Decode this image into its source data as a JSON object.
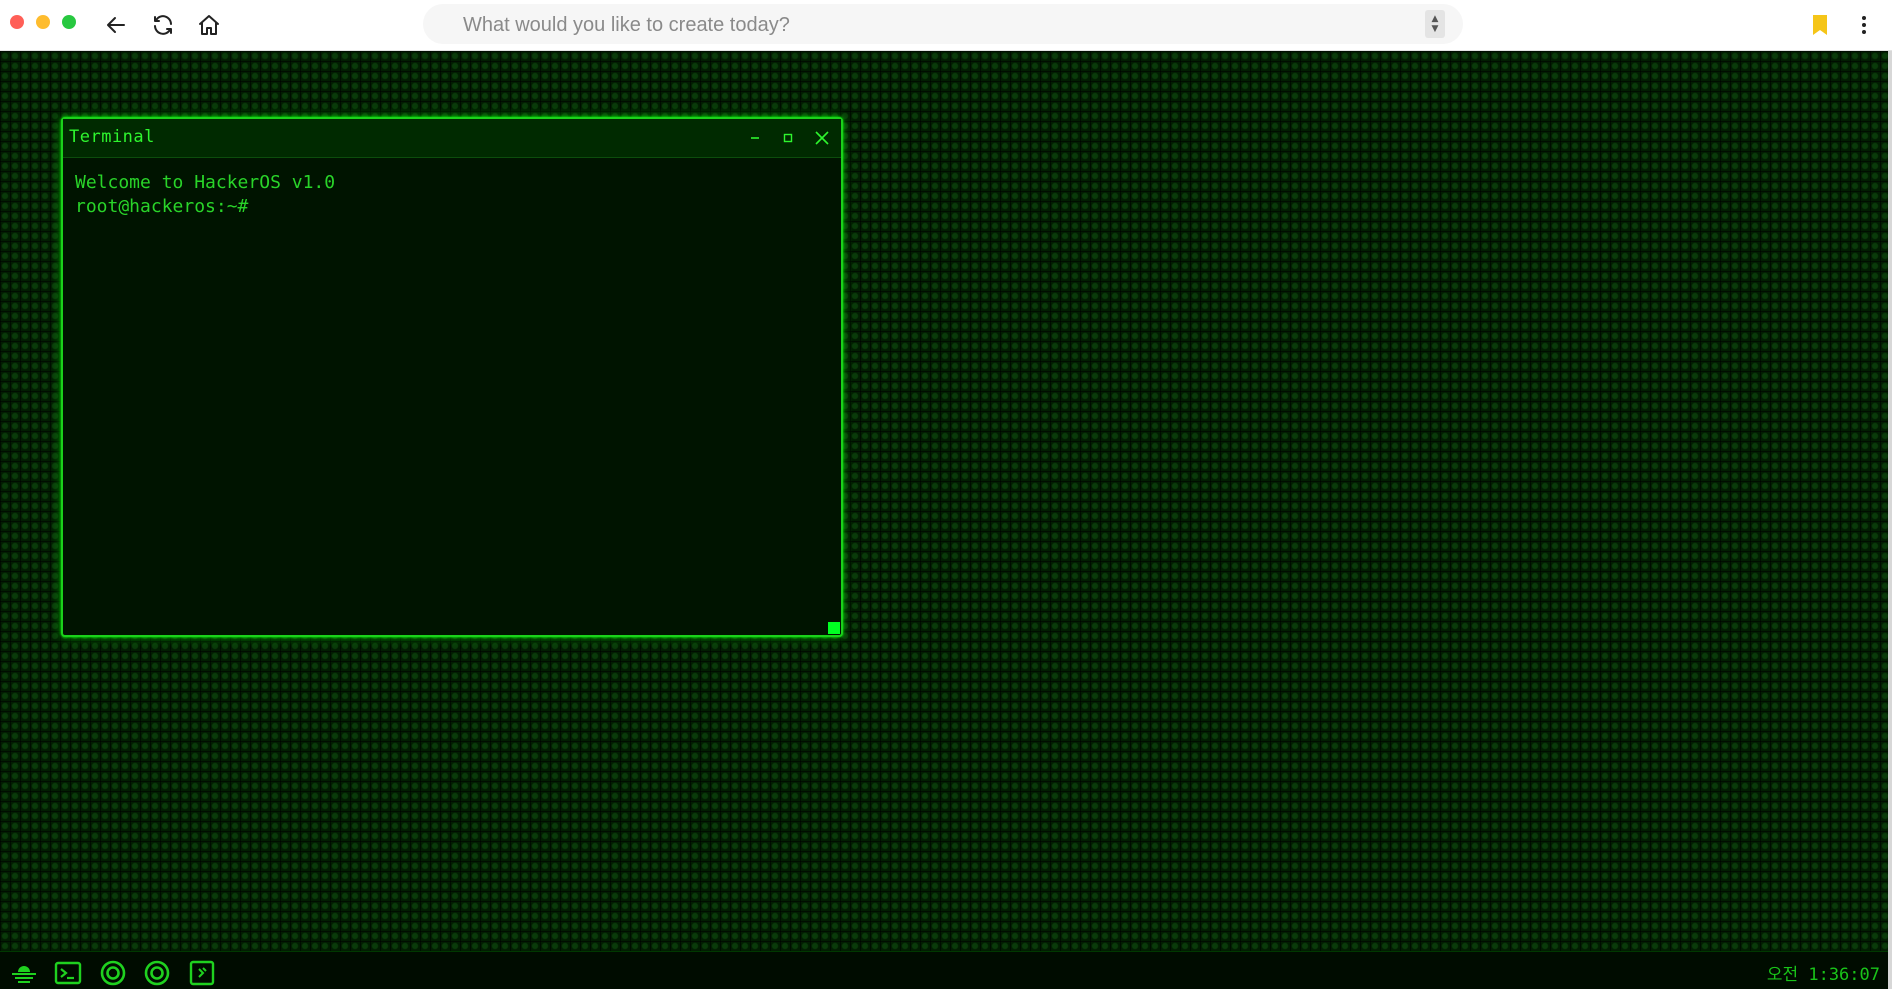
{
  "browser": {
    "url_placeholder": "What would you like to create today?",
    "icons": {
      "back": "arrow-left-icon",
      "reload": "reload-icon",
      "home": "home-icon",
      "bookmark": "bookmark-icon",
      "menu": "kebab-menu-icon"
    },
    "colors": {
      "bookmark": "#f5c518",
      "close_dot": "#ff5f57",
      "minimize_dot": "#febc2e",
      "zoom_dot": "#28c840"
    }
  },
  "desktop": {
    "theme_color": "#00ff00"
  },
  "terminal": {
    "title": "Terminal",
    "controls": {
      "minimize": "minimize-icon",
      "maximize": "maximize-icon",
      "close": "close-icon"
    },
    "lines": [
      "Welcome to HackerOS v1.0",
      "root@hackeros:~#"
    ]
  },
  "taskbar": {
    "items": [
      "start-menu-icon",
      "terminal-icon",
      "app-circle-icon",
      "app-circle-icon",
      "app-square-icon"
    ],
    "clock": "오전 1:36:07"
  }
}
